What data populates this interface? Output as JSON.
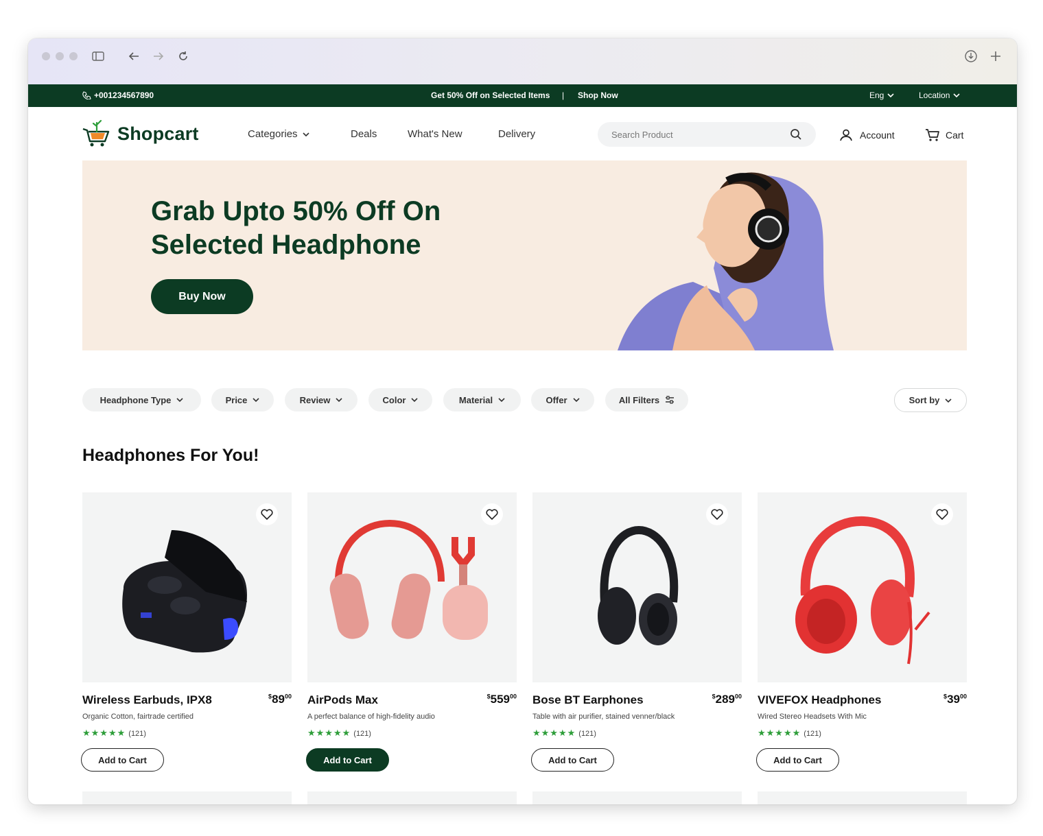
{
  "topbar": {
    "phone": "+001234567890",
    "promo": "Get 50% Off on Selected Items",
    "separator": "|",
    "shop_now": "Shop Now",
    "language": "Eng",
    "location": "Location"
  },
  "header": {
    "brand": "Shopcart",
    "nav": [
      "Categories",
      "Deals",
      "What's New",
      "Delivery"
    ],
    "search_placeholder": "Search Product",
    "account": "Account",
    "cart": "Cart"
  },
  "hero": {
    "title_line1": "Grab Upto 50% Off On",
    "title_line2": "Selected Headphone",
    "button": "Buy Now"
  },
  "filters": [
    "Headphone Type",
    "Price",
    "Review",
    "Color",
    "Material",
    "Offer",
    "All Filters"
  ],
  "sort_label": "Sort by",
  "section_title": "Headphones For You!",
  "products": [
    {
      "name": "Wireless Earbuds, IPX8",
      "price": "89",
      "cents": "00",
      "desc": "Organic Cotton, fairtrade certified",
      "stars": "★★★★★",
      "reviews": "(121)",
      "button": "Add to Cart"
    },
    {
      "name": "AirPods Max",
      "price": "559",
      "cents": "00",
      "desc": "A perfect balance of high-fidelity audio",
      "stars": "★★★★★",
      "reviews": "(121)",
      "button": "Add to Cart"
    },
    {
      "name": "Bose BT Earphones",
      "price": "289",
      "cents": "00",
      "desc": "Table with air purifier, stained venner/black",
      "stars": "★★★★★",
      "reviews": "(121)",
      "button": "Add to Cart"
    },
    {
      "name": "VIVEFOX Headphones",
      "price": "39",
      "cents": "00",
      "desc": "Wired Stereo Headsets With Mic",
      "stars": "★★★★★",
      "reviews": "(121)",
      "button": "Add to Cart"
    }
  ],
  "colors": {
    "brand_green": "#0c3b23",
    "hero_bg": "#f8ece1",
    "star_green": "#2e9e3a"
  }
}
